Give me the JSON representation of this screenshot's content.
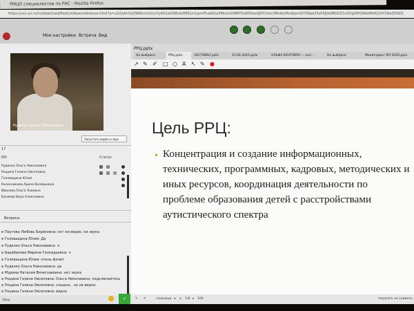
{
  "window": {
    "title": "РМЦО специалистов по РАС - Mozilla Firefox",
    "url": "https://vcs.uu.ru/ru/download/flash/videoconference.html?a=u2VydmVyQWRkcmVzczYydG1wOXBvbXM5Lm1pcmFuaW1aXMuzmUWMTkzNS9zaXJ0Y2xhc3MvbmMvdjlpm5lY3Rpb25zPXJ0b0BGOZ1vZVg5WQ9tbSMdQ2XY29wZ5NZZ"
  },
  "app": {
    "menu": [
      "Мои настройки",
      "Встреча",
      "Вид"
    ],
    "header_buttons": [
      "",
      "",
      "",
      "",
      ""
    ]
  },
  "camera": {
    "participant_name": "Руденко Ольга  Николаевна",
    "label": "",
    "play_button": "Запустить видео и звук"
  },
  "participants": {
    "count": "17",
    "status_header": "Статус",
    "name_header": "ИО",
    "rows": [
      {
        "name": "Руденко Ольга  Николаевна"
      },
      {
        "name": "Рощина Галина Овсеповна"
      },
      {
        "name": "Головащина Юлия"
      },
      {
        "name": "Колесникова Арина  Валерьевна"
      },
      {
        "name": "Иванова Ольга  Львовна"
      },
      {
        "name": "Бачиева Вера  Алексеевна"
      }
    ]
  },
  "chat": {
    "tab": "Вопросы",
    "messages": [
      "Паутова Любовь  Борисовна: нет ни видео, ни звука",
      "Головащина Юлия: Да",
      "Руденко Ольга  Николаевна: +",
      "Барабанова Марина  Геннадьевна: +",
      "Головащина Юлия: очень фонит",
      "Руденко Ольга  Николаевна: да",
      "Мурина Наталия  Вячеславовна: нет звука",
      "Рощина Галина Овсеповна: Ольга Николаевна, подключайтесь",
      "Рощина Галина Овсеповна: слышно , но не видно",
      "Рощина Галина Овсеповна: видно"
    ],
    "input_placeholder": "Ввод"
  },
  "presentation": {
    "window_title": "РРЦ.pptx",
    "tabs": [
      {
        "label": "Не выбрано",
        "active": false
      },
      {
        "label": "РРЦ.pptx",
        "active": true
      },
      {
        "label": "ЗАСТАВКА.pptx",
        "active": false
      },
      {
        "label": "15.06.2020.pptx",
        "active": false
      },
      {
        "label": "АЛЬФА КЕНТАВРА — кол...",
        "active": false
      },
      {
        "label": "Не выбрано",
        "active": false
      },
      {
        "label": "Мониторинг ЯО 2020.pptx",
        "active": false
      }
    ],
    "slide": {
      "title": "Цель РРЦ:",
      "bullet": "Концентрация и создание информационных, технических, программных, кадровых, методических и иных ресурсов, координация деятельности по проблеме образования детей с расстройствами аутистического спектра"
    },
    "status": {
      "page_label": "страница",
      "page_total": "1/8",
      "zoom": "100",
      "right_label": "показать не снимать"
    }
  },
  "colors": {
    "slide_band_dark": "#2e2720",
    "slide_band_orange": "#b86230",
    "bullet": "#d8a030",
    "send_button": "#35a935",
    "header_button": "#2f6e2a"
  }
}
